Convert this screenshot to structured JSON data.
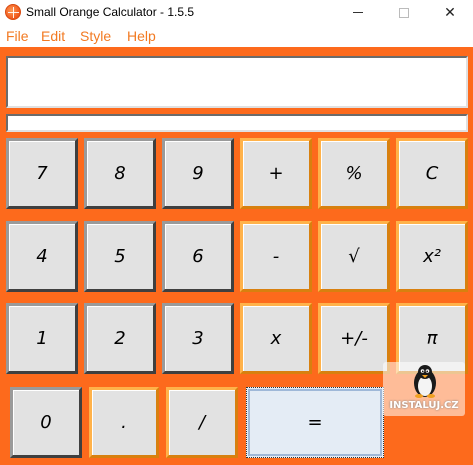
{
  "window": {
    "title": "Small Orange Calculator - 1.5.5",
    "controls": {
      "minimize": "minimize",
      "maximize": "maximize",
      "close": "✕"
    }
  },
  "menu": [
    "File",
    "Edit",
    "Style",
    "Help"
  ],
  "display": {
    "main_value": "",
    "sub_value": ""
  },
  "keys": {
    "row1": [
      "7",
      "8",
      "9",
      "+",
      "%",
      "C"
    ],
    "row2": [
      "4",
      "5",
      "6",
      "-",
      "√",
      "x²"
    ],
    "row3": [
      "1",
      "2",
      "3",
      "x",
      "+/-",
      "π"
    ],
    "row4": [
      "0",
      ".",
      "/",
      "="
    ]
  },
  "watermark": {
    "text": "INSTALUJ.CZ",
    "icon": "tux-penguin-icon"
  },
  "colors": {
    "background": "#fd6a1c",
    "menu_text": "#f27a22",
    "key_face": "#e2e2e2",
    "orange_border": "#ffb24a"
  }
}
